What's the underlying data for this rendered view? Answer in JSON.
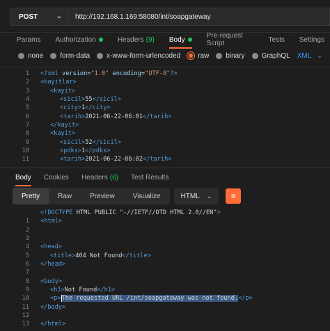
{
  "request": {
    "method": "POST",
    "url": "http://192.168.1.169:58080/int/soapgateway"
  },
  "request_tabs": [
    {
      "label": "Params"
    },
    {
      "label": "Authorization",
      "dot": true
    },
    {
      "label": "Headers",
      "count": "(9)"
    },
    {
      "label": "Body",
      "dot": true,
      "active": true
    },
    {
      "label": "Pre-request Script"
    },
    {
      "label": "Tests"
    },
    {
      "label": "Settings"
    }
  ],
  "body_types": [
    "none",
    "form-data",
    "x-www-form-urlencoded",
    "raw",
    "binary",
    "GraphQL"
  ],
  "body_selected": "raw",
  "body_format": "XML",
  "request_body": [
    {
      "n": "1",
      "t": "<?xml version=\"1.0\" encoding=\"UTF-8\"?>",
      "ind": 0
    },
    {
      "n": "2",
      "t": "<kayitlar>",
      "ind": 0
    },
    {
      "n": "3",
      "t": "<kayit>",
      "ind": 1
    },
    {
      "n": "4",
      "t": "<sicil>55</sicil>",
      "ind": 2
    },
    {
      "n": "5",
      "t": "<city>1</city>",
      "ind": 2
    },
    {
      "n": "6",
      "t": "<tarih>2021-06-22-06:01</tarih>",
      "ind": 2
    },
    {
      "n": "7",
      "t": "</kayit>",
      "ind": 1
    },
    {
      "n": "8",
      "t": "<kayit>",
      "ind": 1
    },
    {
      "n": "9",
      "t": "<sicil>52</sicil>",
      "ind": 2
    },
    {
      "n": "10",
      "t": "<pdks>1</pdks>",
      "ind": 2
    },
    {
      "n": "11",
      "t": "<tarih>2021-06-22-06:02</tarih>",
      "ind": 2
    }
  ],
  "response_tabs": [
    {
      "label": "Body",
      "active": true
    },
    {
      "label": "Cookies"
    },
    {
      "label": "Headers",
      "count": "(6)"
    },
    {
      "label": "Test Results"
    }
  ],
  "response_views": [
    "Pretty",
    "Raw",
    "Preview",
    "Visualize"
  ],
  "response_view_selected": "Pretty",
  "response_format": "HTML",
  "response_body": [
    {
      "n": "",
      "t": "<!DOCTYPE HTML PUBLIC \"-//IETF//DTD HTML 2.0//EN\">",
      "ind": 0
    },
    {
      "n": "1",
      "t": "<html>",
      "ind": 0
    },
    {
      "n": "2",
      "t": "",
      "ind": 0
    },
    {
      "n": "3",
      "t": "",
      "ind": 0
    },
    {
      "n": "4",
      "t": "<head>",
      "ind": 0
    },
    {
      "n": "5",
      "t": "<title>404 Not Found</title>",
      "ind": 1
    },
    {
      "n": "6",
      "t": "</head>",
      "ind": 0
    },
    {
      "n": "7",
      "t": "",
      "ind": 0
    },
    {
      "n": "8",
      "t": "<body>",
      "ind": 0
    },
    {
      "n": "9",
      "t": "<h1>Not Found</h1>",
      "ind": 1
    },
    {
      "n": "10",
      "t": "<p>The requested URL /int/soapgateway was not found.</p>",
      "ind": 1,
      "highlight": "The requested URL /int/soapgateway was not found."
    },
    {
      "n": "11",
      "t": "</body>",
      "ind": 0
    },
    {
      "n": "12",
      "t": "",
      "ind": 0
    },
    {
      "n": "13",
      "t": "</html>",
      "ind": 0
    }
  ],
  "colors": {
    "accent": "#ff6c37",
    "status_dot": "#20c35e",
    "link": "#3b9cf2"
  }
}
